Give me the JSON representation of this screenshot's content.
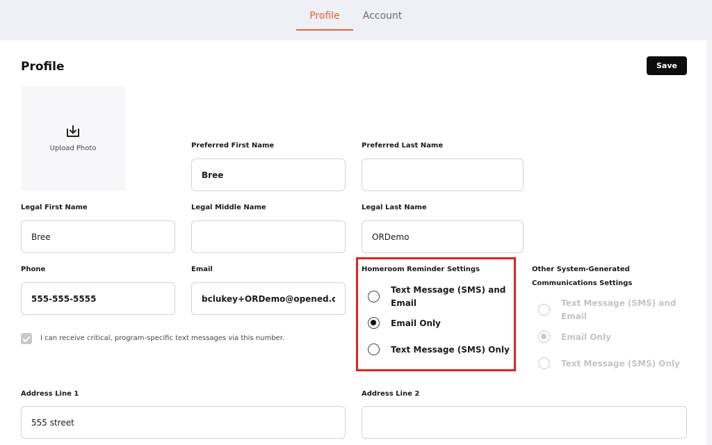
{
  "tabs": [
    {
      "label": "Profile",
      "active": true
    },
    {
      "label": "Account",
      "active": false
    }
  ],
  "page": {
    "title": "Profile",
    "save_label": "Save"
  },
  "upload": {
    "label": "Upload Photo",
    "icon": "upload-icon"
  },
  "fields": {
    "preferred_first": {
      "label": "Preferred First Name",
      "value": "Bree"
    },
    "preferred_last": {
      "label": "Preferred Last Name",
      "value": ""
    },
    "legal_first": {
      "label": "Legal First Name",
      "value": "Bree"
    },
    "legal_middle": {
      "label": "Legal Middle Name",
      "value": ""
    },
    "legal_last": {
      "label": "Legal Last Name",
      "value": "ORDemo"
    },
    "phone": {
      "label": "Phone",
      "value": "555-555-5555"
    },
    "email": {
      "label": "Email",
      "value": "bclukey+ORDemo@opened.co"
    },
    "address1": {
      "label": "Address Line 1",
      "value": "555 street"
    },
    "address2": {
      "label": "Address Line 2",
      "value": ""
    }
  },
  "sms_consent": {
    "label": "I can receive critical, program-specific text messages via this number.",
    "checked": true
  },
  "homeroom": {
    "title": "Homeroom Reminder Settings",
    "options": [
      {
        "label": "Text Message (SMS) and Email",
        "selected": false
      },
      {
        "label": "Email Only",
        "selected": true
      },
      {
        "label": "Text Message (SMS) Only",
        "selected": false
      }
    ]
  },
  "other": {
    "title": "Other System-Generated Communications Settings",
    "disabled": true,
    "options": [
      {
        "label": "Text Message (SMS) and Email",
        "selected": false
      },
      {
        "label": "Email Only",
        "selected": true
      },
      {
        "label": "Text Message (SMS) Only",
        "selected": false
      }
    ]
  },
  "colors": {
    "accent": "#e8612c",
    "highlight": "#e0231f",
    "button": "#0d0d0d"
  }
}
